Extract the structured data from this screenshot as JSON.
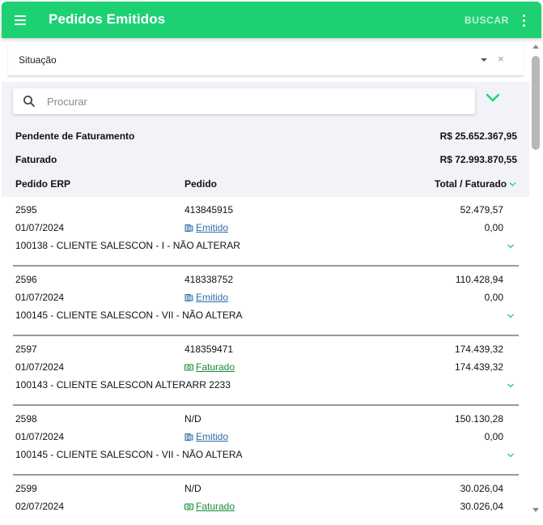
{
  "header": {
    "title": "Pedidos Emitidos",
    "search_action": "BUSCAR",
    "menu_icon": "menu-icon",
    "more_icon": "more-vertical-icon"
  },
  "filter": {
    "label": "Situação",
    "clear_symbol": "×"
  },
  "search": {
    "placeholder": "Procurar"
  },
  "summary": {
    "pending_label": "Pendente de Faturamento",
    "pending_value": "R$ 25.652.367,95",
    "billed_label": "Faturado",
    "billed_value": "R$ 72.993.870,55"
  },
  "columns": {
    "erp": "Pedido ERP",
    "pedido": "Pedido",
    "total": "Total / Faturado"
  },
  "colors": {
    "accent": "#1dd173",
    "emitido": "#2e6da4",
    "faturado": "#1a8a3c",
    "summary_bg": "#f2f3f8"
  },
  "orders": [
    {
      "erp": "2595",
      "date": "01/07/2024",
      "pedido": "413845915",
      "status": "Emitido",
      "status_type": "emitido",
      "total": "52.479,57",
      "faturado": "0,00",
      "client": "100138 - CLIENTE SALESCON - I - NÃO ALTERAR"
    },
    {
      "erp": "2596",
      "date": "01/07/2024",
      "pedido": "418338752",
      "status": "Emitido",
      "status_type": "emitido",
      "total": "110.428,94",
      "faturado": "0,00",
      "client": "100145 - CLIENTE SALESCON - VII - NÃO ALTERA"
    },
    {
      "erp": "2597",
      "date": "01/07/2024",
      "pedido": "418359471",
      "status": "Faturado",
      "status_type": "faturado",
      "total": "174.439,32",
      "faturado": "174.439,32",
      "client": "100143 - CLIENTE SALESCON ALTERARR 2233"
    },
    {
      "erp": "2598",
      "date": "01/07/2024",
      "pedido": "N/D",
      "status": "Emitido",
      "status_type": "emitido",
      "total": "150.130,28",
      "faturado": "0,00",
      "client": "100145 - CLIENTE SALESCON - VII - NÃO ALTERA"
    },
    {
      "erp": "2599",
      "date": "02/07/2024",
      "pedido": "N/D",
      "status": "Faturado",
      "status_type": "faturado",
      "total": "30.026,04",
      "faturado": "30.026,04",
      "client": ""
    }
  ]
}
